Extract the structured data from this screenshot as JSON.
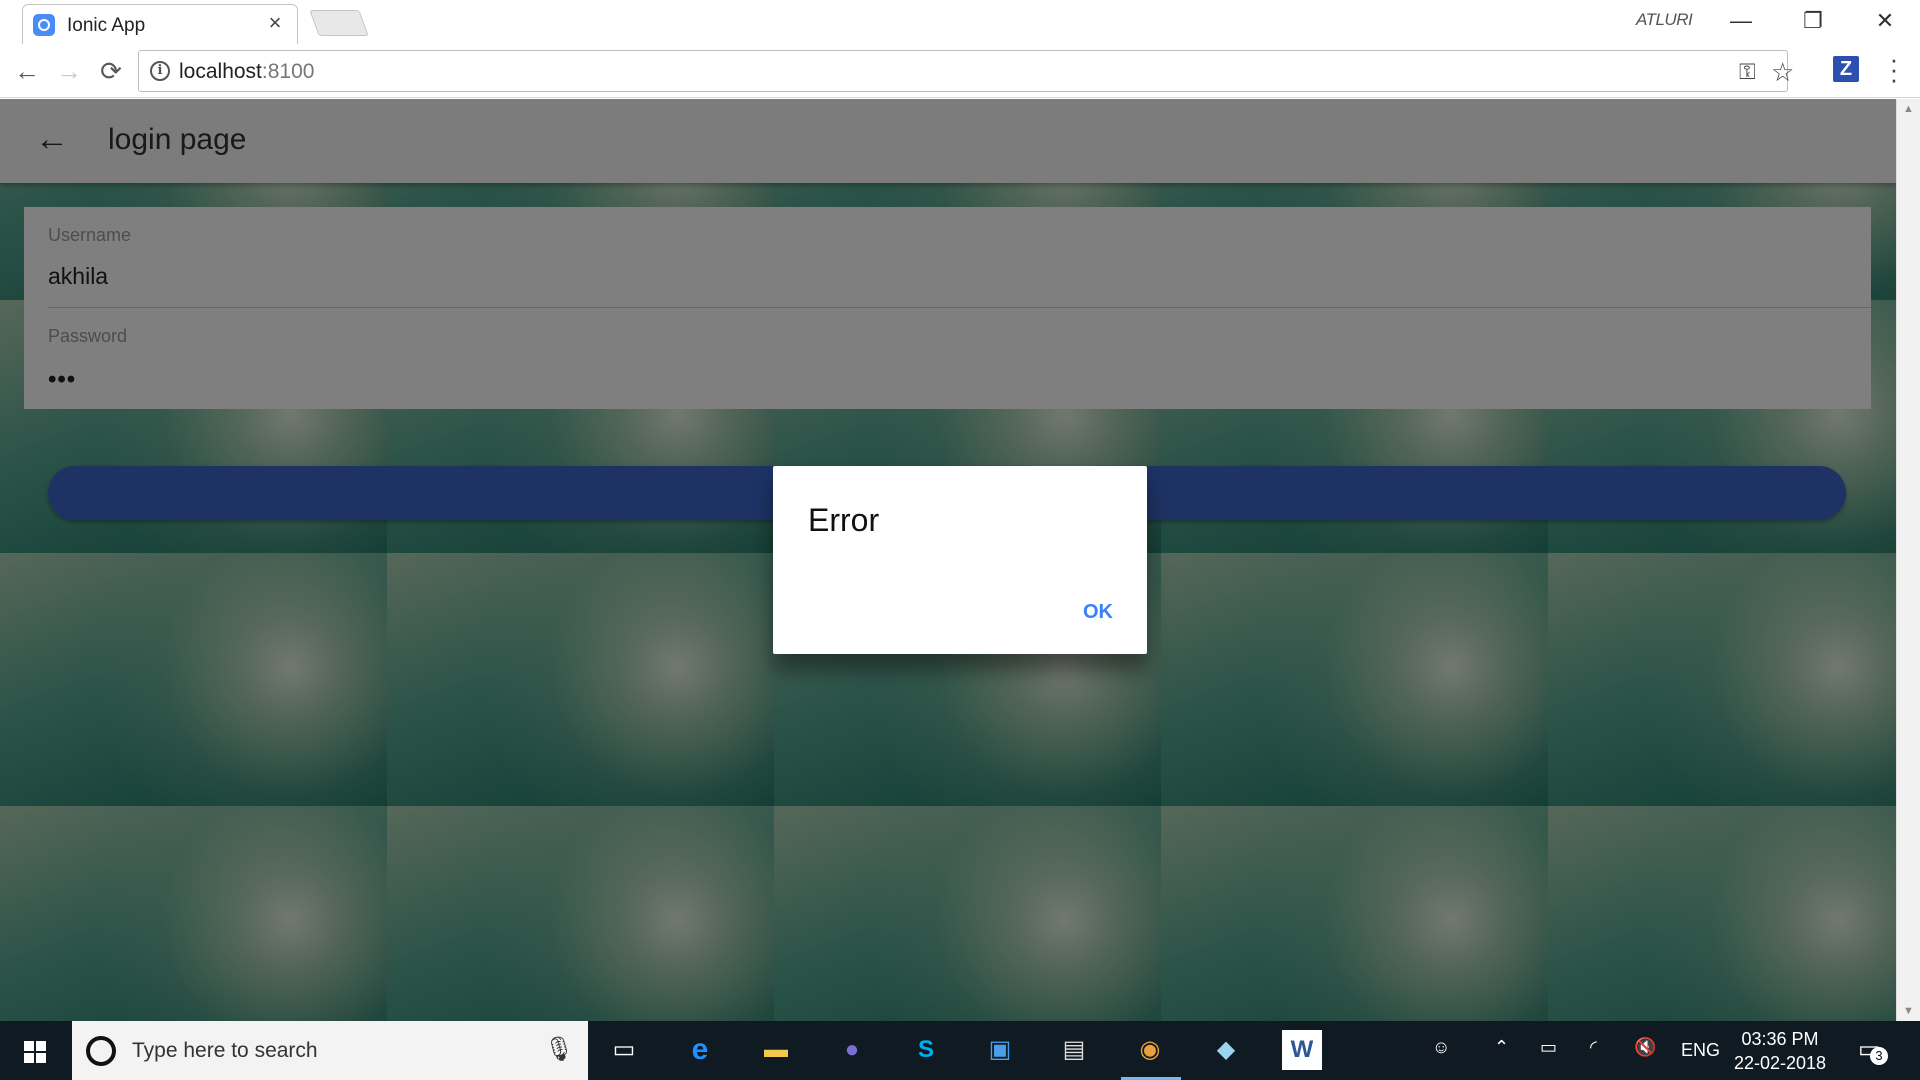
{
  "browser": {
    "tab_title": "Ionic App",
    "tab_close": "×",
    "profile_name": "ATLURI",
    "url_host": "localhost",
    "url_port": ":8100",
    "window_minimize": "—",
    "window_restore": "❐",
    "window_close": "✕",
    "back": "←",
    "forward": "→",
    "reload": "⟳",
    "ext_letter": "Z"
  },
  "app": {
    "title": "login page",
    "back": "←",
    "username_label": "Username",
    "username_value": "akhila",
    "password_label": "Password",
    "password_value": "•••"
  },
  "alert": {
    "title": "Error",
    "ok_label": "OK"
  },
  "taskbar": {
    "search_placeholder": "Type here to search",
    "language": "ENG",
    "time": "03:36 PM",
    "date": "22-02-2018",
    "notification_count": "3"
  },
  "colors": {
    "primary_button": "#3c66c8",
    "alert_button": "#3880ff",
    "taskbar": "#101a22"
  }
}
